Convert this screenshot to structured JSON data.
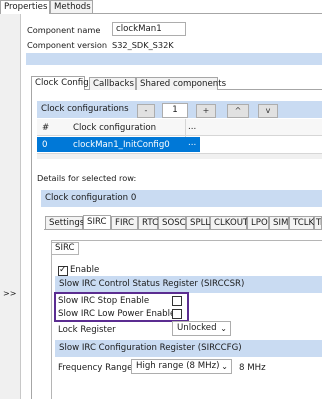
{
  "tabs": {
    "properties": "Properties",
    "methods": "Methods"
  },
  "collapse_label": ">>",
  "component": {
    "name_label": "Component name",
    "name_value": "clockMan1",
    "version_label": "Component version",
    "version_value": "S32_SDK_S32K"
  },
  "inner_tabs": [
    "Clock Config",
    "Callbacks",
    "Shared components"
  ],
  "configs": {
    "title": "Clock configurations",
    "minus": "-",
    "count": "1",
    "plus": "+",
    "up": "^",
    "down": "v",
    "col_index": "#",
    "col_name": "Clock configuration",
    "col_more": "...",
    "rows": [
      {
        "index": "0",
        "name": "clockMan1_InitConfig0",
        "more": "..."
      }
    ]
  },
  "details_label": "Details for selected row:",
  "clock_config_label": "Clock configuration 0",
  "detail_tabs": [
    "Settings",
    "SIRC",
    "FIRC",
    "RTC",
    "SOSC",
    "SPLL",
    "CLKOUT",
    "LPO",
    "SIM",
    "TCLK",
    "Tr"
  ],
  "sirc": {
    "group_label": "SIRC",
    "enable_label": "Enable",
    "enable_checked": true,
    "csr_header": "Slow IRC Control Status Register (SIRCCSR)",
    "stop_enable_label": "Slow IRC Stop Enable",
    "low_power_label": "Slow IRC Low Power Enable",
    "lock_label": "Lock Register",
    "lock_value": "Unlocked",
    "cfg_header": "Slow IRC Configuration Register (SIRCCFG)",
    "freq_label": "Frequency Range",
    "freq_value": "High range (8 MHz)",
    "freq_result": "8 MHz"
  },
  "colors": {
    "highlight": "#5b2d91",
    "selected_row": "#0078d7",
    "header_bg": "#c9dbf2"
  }
}
